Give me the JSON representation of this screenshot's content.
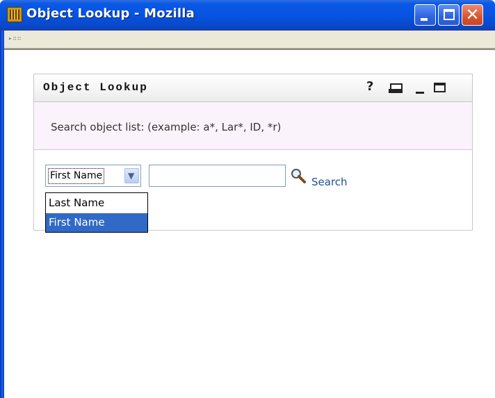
{
  "window": {
    "title": "Object Lookup - Mozilla",
    "controls": [
      "minimize",
      "maximize",
      "close"
    ]
  },
  "toolbar": {
    "grip": "▸∷∷"
  },
  "portlet": {
    "title": "Object Lookup",
    "header_icons": {
      "help": "?",
      "print": "print-icon",
      "minimize": "minimize-icon",
      "maximize": "maximize-icon"
    },
    "instruction": "Search object list: (example: a*, Lar*, ID, *r)"
  },
  "search": {
    "field_select": {
      "selected": "First Name",
      "options": [
        "Last Name",
        "First Name"
      ],
      "highlighted": "First Name"
    },
    "query_value": "",
    "search_label": "Search"
  },
  "colors": {
    "titlebar": "#0654e0",
    "highlight": "#3169c6",
    "link": "#1f4fa0",
    "instruction_band": "#fbf3fb"
  }
}
